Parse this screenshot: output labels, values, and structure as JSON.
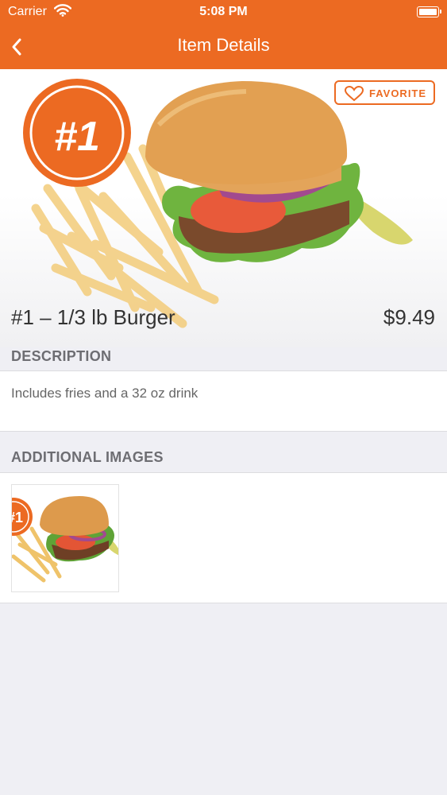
{
  "status_bar": {
    "carrier": "Carrier",
    "time": "5:08 PM"
  },
  "nav": {
    "title": "Item Details",
    "back_icon": "chevron-left-icon"
  },
  "hero": {
    "badge_text": "#1",
    "favorite_label": "FAVORITE",
    "favorite_icon": "heart-outline-icon"
  },
  "item": {
    "name": "#1 – 1/3 lb Burger",
    "price": "$9.49"
  },
  "description": {
    "header": "DESCRIPTION",
    "text": "Includes fries and a 32 oz drink"
  },
  "additional_images": {
    "header": "ADDITIONAL IMAGES",
    "thumb_badge": "#1"
  },
  "colors": {
    "accent": "#ec6a22",
    "background": "#efeff4",
    "section_header": "#6d6d72"
  }
}
